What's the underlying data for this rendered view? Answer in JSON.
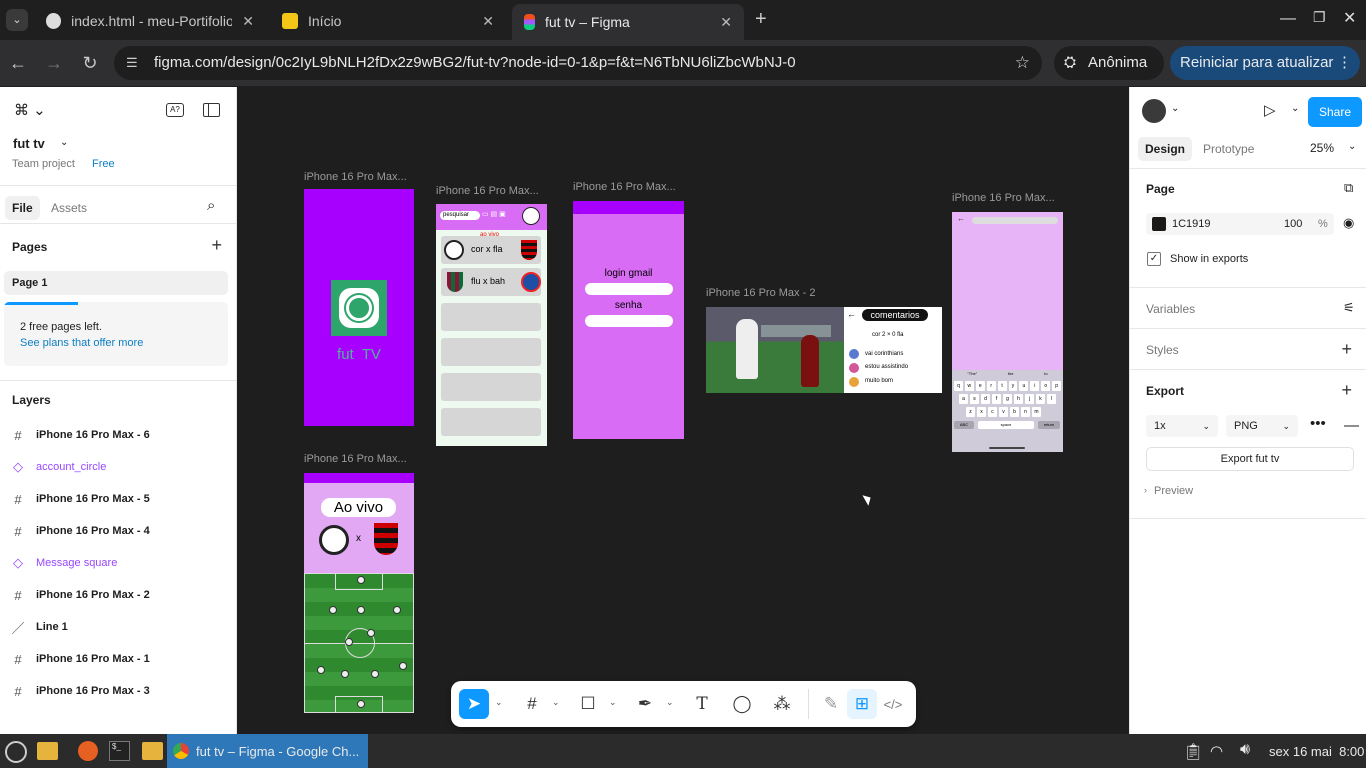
{
  "browser": {
    "tabs": [
      {
        "title": "index.html - meu-Portifolio"
      },
      {
        "title": "Início"
      },
      {
        "title": "fut tv – Figma"
      }
    ],
    "url": "figma.com/design/0c2IyL9bNLH2fDx2z9wBG2/fut-tv?node-id=0-1&p=f&t=N6TbNU6liZbcWbNJ-0",
    "incognito_label": "Anônima",
    "restart_label": "Reiniciar para atualizar"
  },
  "left": {
    "file_name": "fut tv",
    "team": "Team project",
    "plan_badge": "Free",
    "tabs": [
      "File",
      "Assets"
    ],
    "pages_title": "Pages",
    "current_page": "Page 1",
    "free_pages_notice": "2 free pages left.",
    "see_plans_link": "See plans that offer more",
    "layers_title": "Layers",
    "layers": [
      {
        "name": "iPhone 16 Pro Max - 6",
        "kind": "frame"
      },
      {
        "name": "account_circle",
        "kind": "component"
      },
      {
        "name": "iPhone 16 Pro Max - 5",
        "kind": "frame"
      },
      {
        "name": "iPhone 16 Pro Max - 4",
        "kind": "frame"
      },
      {
        "name": "Message square",
        "kind": "component"
      },
      {
        "name": "iPhone 16 Pro Max - 2",
        "kind": "frame"
      },
      {
        "name": "Line 1",
        "kind": "line"
      },
      {
        "name": "iPhone 16 Pro Max - 1",
        "kind": "frame"
      },
      {
        "name": "iPhone 16 Pro Max - 3",
        "kind": "frame"
      }
    ]
  },
  "canvas": {
    "frame_labels": {
      "f1": "iPhone 16 Pro Max...",
      "f2": "iPhone 16 Pro Max...",
      "f3": "iPhone 16 Pro Max...",
      "f4": "iPhone 16 Pro Max - 2",
      "f5": "iPhone 16 Pro Max...",
      "f6": "iPhone 16 Pro Max..."
    },
    "splash_text": "fut  TV",
    "home": {
      "search": "pesquisar",
      "live_tag": "ao vivo",
      "match1": "cor x fla",
      "match2": "flu x bah"
    },
    "login": {
      "gmail": "login gmail",
      "password": "senha"
    },
    "comments": {
      "title": "comentarios",
      "score": "cor 2 × 0 fla",
      "items": [
        "vai corinthians",
        "estou assistindo",
        "muito bom"
      ]
    },
    "live": {
      "title": "Ao vivo",
      "versus": "x"
    },
    "keyboard": {
      "row1": [
        "q",
        "w",
        "e",
        "r",
        "t",
        "y",
        "u",
        "i",
        "o",
        "p"
      ],
      "row2": [
        "a",
        "s",
        "d",
        "f",
        "g",
        "h",
        "j",
        "k",
        "l"
      ],
      "row3": [
        "z",
        "x",
        "c",
        "v",
        "b",
        "n",
        "m"
      ],
      "abc": "ABC",
      "space": "space",
      "return": "return",
      "suggest": [
        "\"The\"",
        "the",
        "to"
      ]
    }
  },
  "right": {
    "tabs": [
      "Design",
      "Prototype"
    ],
    "zoom": "25%",
    "share_label": "Share",
    "page_title": "Page",
    "page_color": "1C1919",
    "page_opacity": "100",
    "opacity_unit": "%",
    "show_in_exports": "Show in exports",
    "variables": "Variables",
    "styles": "Styles",
    "export_title": "Export",
    "export_scale": "1x",
    "export_format": "PNG",
    "export_button": "Export fut tv",
    "preview": "Preview"
  },
  "taskbar": {
    "window_title": "fut tv – Figma - Google Ch...",
    "clock": "sex 16 mai  8:00"
  },
  "colors": {
    "purple": "#a800ff",
    "lilac": "#d86cf5",
    "accent": "#0d99ff",
    "grass": "#2e8b2e"
  }
}
